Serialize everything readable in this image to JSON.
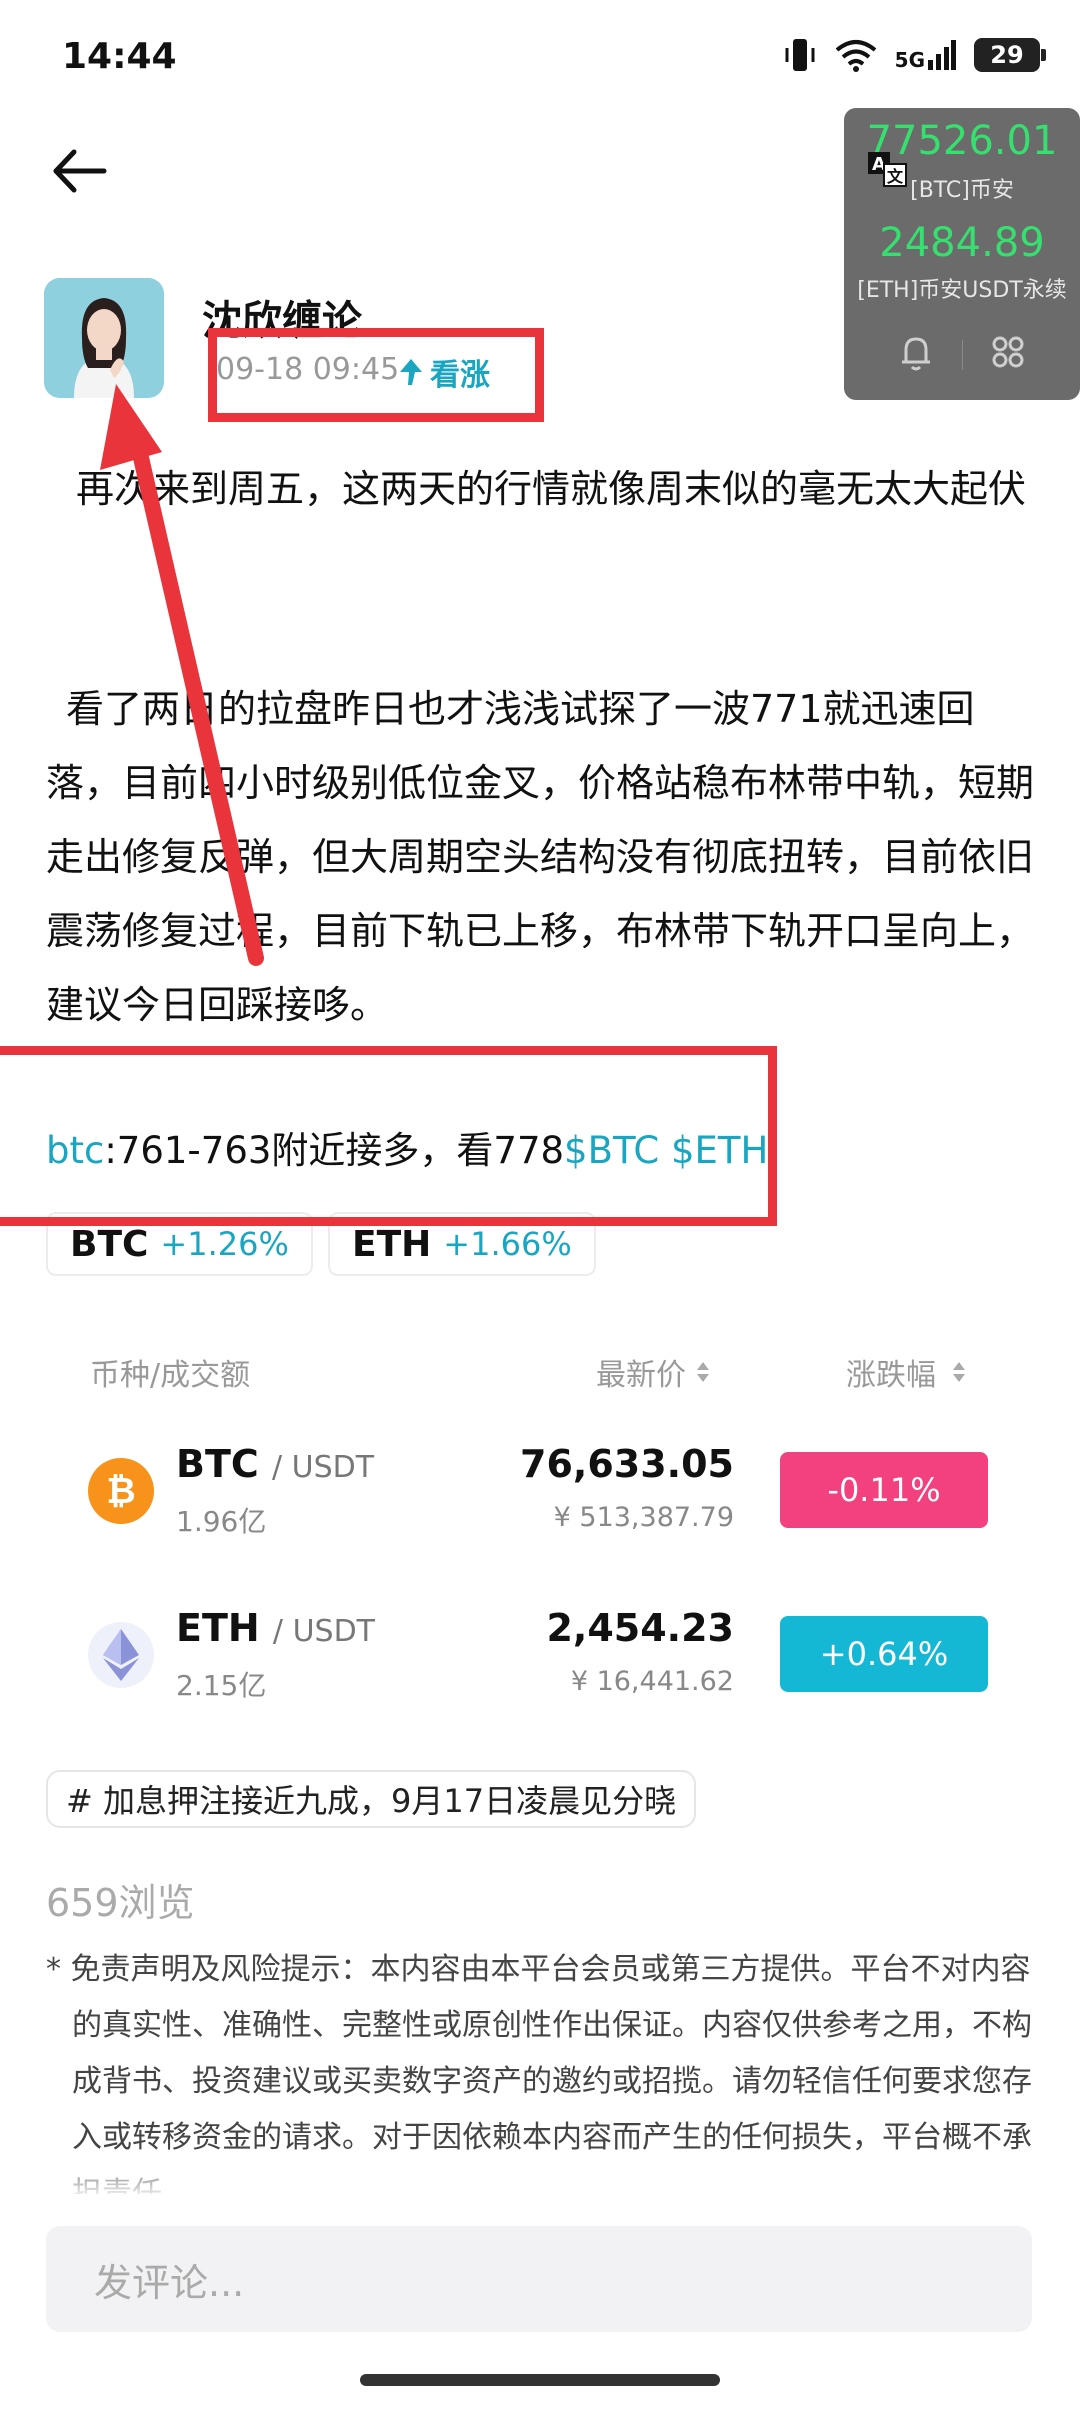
{
  "status_bar": {
    "time": "14:44",
    "network": "5G",
    "battery": "29"
  },
  "ticker": {
    "btc_price": "77526.01",
    "btc_label": "[BTC]币安",
    "eth_price": "2484.89",
    "eth_label": "[ETH]币安USDT永续"
  },
  "author": {
    "name": "沈欣缠论",
    "time": "09-18 09:45",
    "sentiment": "看涨"
  },
  "post": {
    "para1": "再次来到周五，这两天的行情就像周末似的毫无太大起伏",
    "para2": "看了两日的拉盘昨日也才浅浅试探了一波771就迅速回落，目前四小时级别低位金叉，价格站稳布林带中轨，短期走出修复反弹，但大周期空头结构没有彻底扭转，目前依旧震荡修复过程，目前下轨已上移，布林带下轨开口呈向上，建议今日回踩接哆。",
    "btc_prefix": "btc",
    "para3_text": ":761-763附近接多，看778",
    "tags": "$BTC $ETH"
  },
  "chips": [
    {
      "symbol": "BTC",
      "change": "+1.26%"
    },
    {
      "symbol": "ETH",
      "change": "+1.66%"
    }
  ],
  "table": {
    "col_pair": "币种/成交额",
    "col_price": "最新价",
    "col_change": "涨跌幅",
    "rows": [
      {
        "base": "BTC",
        "quote": "/ USDT",
        "volume": "1.96亿",
        "price": "76,633.05",
        "cny": "¥ 513,387.79",
        "change": "-0.11%",
        "color": "#f2417e"
      },
      {
        "base": "ETH",
        "quote": "/ USDT",
        "volume": "2.15亿",
        "price": "2,454.23",
        "cny": "¥ 16,441.62",
        "change": "+0.64%",
        "color": "#15b8d4"
      }
    ]
  },
  "topic": "# 加息押注接近九成，9月17日凌晨见分晓",
  "views": "659浏览",
  "disclaimer": "* 免责声明及风险提示：本内容由本平台会员或第三方提供。平台不对内容的真实性、准确性、完整性或原创性作出保证。内容仅供参考之用，不构成背书、投资建议或买卖数字资产的邀约或招揽。请勿轻信任何要求您存入或转移资金的请求。对于因依赖本内容而产生的任何损失，平台概不承担责任。",
  "comment_placeholder": "发评论..."
}
